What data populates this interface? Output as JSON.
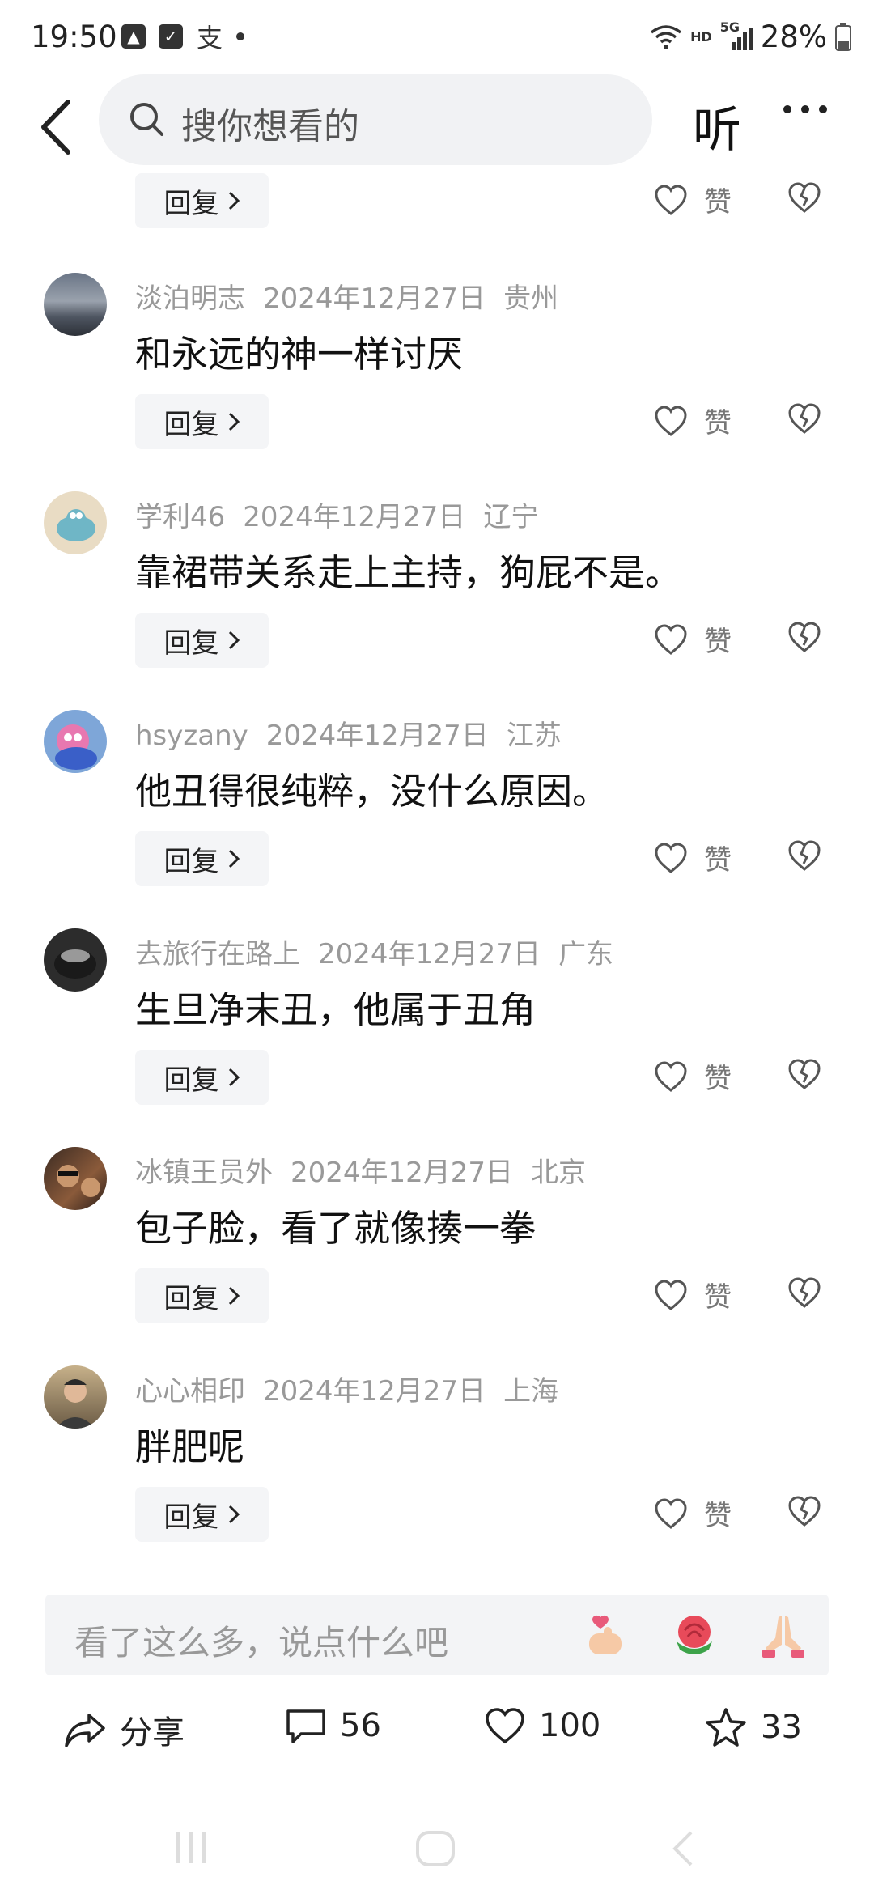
{
  "status_bar": {
    "time": "19:50",
    "battery": "28%",
    "network": "5G",
    "hd": "HD",
    "app_glyph": "支"
  },
  "header": {
    "search_placeholder": "搜你想看的",
    "listen_label": "听"
  },
  "labels": {
    "reply": "回复",
    "like": "赞"
  },
  "comments": [
    {
      "user": "淡泊明志",
      "date": "2024年12月27日",
      "location": "贵州",
      "text": "和永远的神一样讨厌"
    },
    {
      "user": "学利46",
      "date": "2024年12月27日",
      "location": "辽宁",
      "text": "靠裙带关系走上主持，狗屁不是。"
    },
    {
      "user": "hsyzany",
      "date": "2024年12月27日",
      "location": "江苏",
      "text": "他丑得很纯粹，没什么原因。"
    },
    {
      "user": "去旅行在路上",
      "date": "2024年12月27日",
      "location": "广东",
      "text": "生旦净末丑，他属于丑角"
    },
    {
      "user": "冰镇王员外",
      "date": "2024年12月27日",
      "location": "北京",
      "text": "包子脸，看了就像揍一拳"
    },
    {
      "user": "心心相印",
      "date": "2024年12月27日",
      "location": "上海",
      "text": "胖肥呢"
    }
  ],
  "input": {
    "placeholder": "看了这么多，说点什么吧"
  },
  "actions": {
    "share_label": "分享",
    "comments_count": "56",
    "likes_count": "100",
    "favorites_count": "33"
  },
  "colors": {
    "accent_text": "#111111",
    "meta_text": "#999999",
    "reply_bg": "#f4f5f7"
  }
}
